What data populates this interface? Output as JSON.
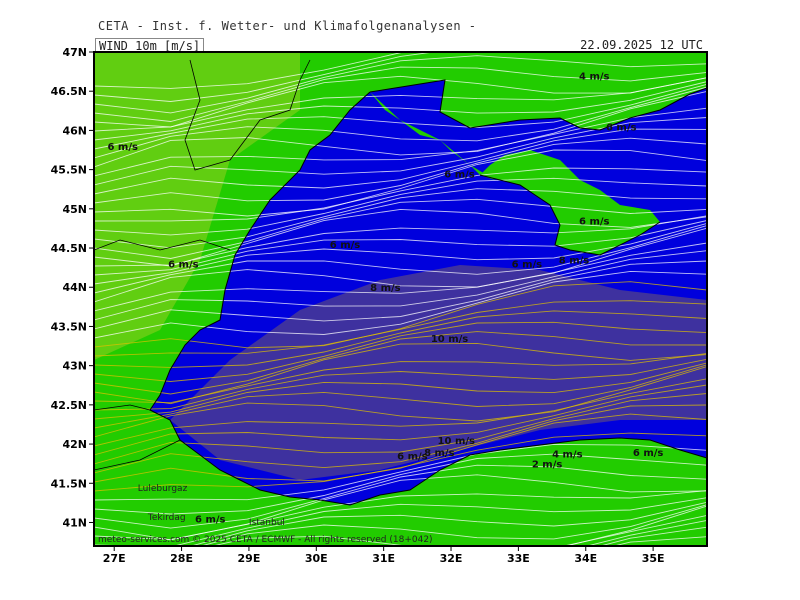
{
  "header": {
    "title": "CETA - Inst. f. Wetter- und Klimafolgenanalysen -",
    "field": "WIND 10m [m/s]",
    "datetime": "22.09.2025 12 UTC"
  },
  "map": {
    "lat_labels": [
      "47N",
      "46.5N",
      "46N",
      "45.5N",
      "45N",
      "44.5N",
      "44N",
      "43.5N",
      "43N",
      "42.5N",
      "42N",
      "41.5N",
      "41N"
    ],
    "lat_values": [
      47,
      46.5,
      46,
      45.5,
      45,
      44.5,
      44,
      43.5,
      43,
      42.5,
      42,
      41.5,
      41
    ],
    "lon_labels": [
      "27E",
      "28E",
      "29E",
      "30E",
      "31E",
      "32E",
      "33E",
      "34E",
      "35E"
    ],
    "lon_values": [
      27,
      28,
      29,
      30,
      31,
      32,
      33,
      34,
      35
    ],
    "extent": {
      "lon_min": 26.7,
      "lon_max": 35.8,
      "lat_min": 40.7,
      "lat_max": 47.0
    },
    "colors": {
      "sea": "#0000dd",
      "land_wind": "#22cc00",
      "strong_wind": "#e0c000",
      "streamline": "#ffffff",
      "frame": "#000000"
    },
    "annotations": [
      {
        "text": "4 m/s",
        "lon": 33.9,
        "lat": 46.65
      },
      {
        "text": "6 m/s",
        "lon": 34.3,
        "lat": 46.0
      },
      {
        "text": "6 m/s",
        "lon": 26.9,
        "lat": 45.75
      },
      {
        "text": "6 m/s",
        "lon": 31.9,
        "lat": 45.4
      },
      {
        "text": "6 m/s",
        "lon": 30.2,
        "lat": 44.5
      },
      {
        "text": "6 m/s",
        "lon": 27.8,
        "lat": 44.25
      },
      {
        "text": "6 m/s",
        "lon": 33.9,
        "lat": 44.8
      },
      {
        "text": "6 m/s",
        "lon": 32.9,
        "lat": 44.25
      },
      {
        "text": "8 m/s",
        "lon": 33.6,
        "lat": 44.3
      },
      {
        "text": "8 m/s",
        "lon": 30.8,
        "lat": 43.95
      },
      {
        "text": "10 m/s",
        "lon": 31.7,
        "lat": 43.3
      },
      {
        "text": "10 m/s",
        "lon": 31.8,
        "lat": 42.0
      },
      {
        "text": "8 m/s",
        "lon": 31.6,
        "lat": 41.85
      },
      {
        "text": "6 m/s",
        "lon": 31.2,
        "lat": 41.8
      },
      {
        "text": "4 m/s",
        "lon": 33.5,
        "lat": 41.83
      },
      {
        "text": "2 m/s",
        "lon": 33.2,
        "lat": 41.7
      },
      {
        "text": "6 m/s",
        "lon": 34.7,
        "lat": 41.85
      },
      {
        "text": "6 m/s",
        "lon": 28.2,
        "lat": 41.0
      }
    ],
    "places": [
      {
        "text": "Luleburgaz",
        "lon": 27.35,
        "lat": 41.4
      },
      {
        "text": "Tekirdag",
        "lon": 27.5,
        "lat": 41.03
      },
      {
        "text": "Istanbul",
        "lon": 29.0,
        "lat": 40.97
      }
    ],
    "credit": "meteo-services.com © 2025 CETA / ECMWF - All rights reserved (18+042)"
  }
}
